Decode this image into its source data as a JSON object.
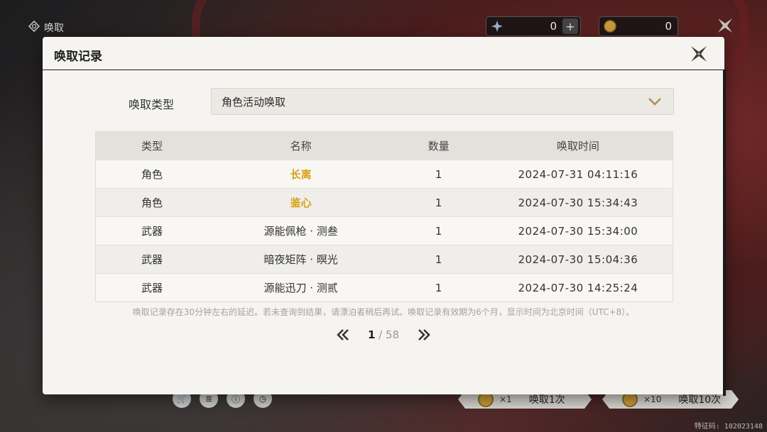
{
  "page": {
    "title": "唤取",
    "currency1_value": "0",
    "currency2_value": "0",
    "fid": "特征码: 102023148",
    "pull_one": {
      "multiplier": "×1",
      "label": "唤取1次"
    },
    "pull_ten": {
      "multiplier": "×10",
      "label": "唤取10次"
    }
  },
  "modal": {
    "title": "唤取记录",
    "filter_label": "唤取类型",
    "filter_value": "角色活动唤取",
    "columns": [
      "类型",
      "名称",
      "数量",
      "唤取时间"
    ],
    "rows": [
      {
        "type": "角色",
        "name": "长离",
        "qty": "1",
        "time": "2024-07-31 04:11:16",
        "highlight": true
      },
      {
        "type": "角色",
        "name": "鉴心",
        "qty": "1",
        "time": "2024-07-30 15:34:43",
        "highlight": true
      },
      {
        "type": "武器",
        "name": "源能佩枪 · 测叁",
        "qty": "1",
        "time": "2024-07-30 15:34:00",
        "highlight": false
      },
      {
        "type": "武器",
        "name": "暗夜矩阵 · 暝光",
        "qty": "1",
        "time": "2024-07-30 15:04:36",
        "highlight": false
      },
      {
        "type": "武器",
        "name": "源能迅刀 · 测贰",
        "qty": "1",
        "time": "2024-07-30 14:25:24",
        "highlight": false
      }
    ],
    "note": "唤取记录存在30分钟左右的延迟。若未查询到结果，请漂泊者稍后再试。唤取记录有效期为6个月，显示时间为北京时间（UTC+8）。",
    "pagination": {
      "current": "1",
      "separator": " / ",
      "total": "58"
    }
  },
  "colors": {
    "highlight": "#d6a21a",
    "accent": "#6e1f22"
  }
}
